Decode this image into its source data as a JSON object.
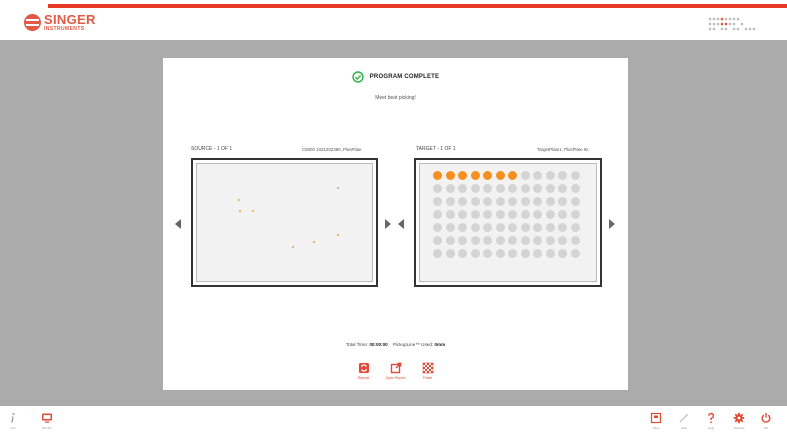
{
  "brand": {
    "name": "SINGER",
    "sub": "INSTRUMENTS",
    "color": "#e05a45"
  },
  "status": {
    "title": "PROGRAM COMPLETE",
    "subtitle": "Meet beat picking!"
  },
  "source": {
    "label": "SOURCE - 1 OF 1",
    "meta": "C9000 1021202390, PlusPlate"
  },
  "target": {
    "label": "TARGET - 1 OF 1",
    "meta": "TargetPlate1, PlusPlate 9x",
    "wells": {
      "rows": 7,
      "cols": 12,
      "filled_in_first_row": 7
    }
  },
  "summary": {
    "total_time_label": "Total Time:",
    "total_time": "00:00:00",
    "pickup_label": "PickupLine™ Used:",
    "pickup_value": "0mm"
  },
  "actions": [
    {
      "label": "Repeat",
      "icon": "repeat-icon"
    },
    {
      "label": "Open Report",
      "icon": "open-report-icon"
    },
    {
      "label": "Finish",
      "icon": "finish-flag-icon"
    }
  ],
  "footer": {
    "left": [
      {
        "label": "Info",
        "icon": "info-icon"
      },
      {
        "label": "Monitor",
        "icon": "monitor-icon"
      }
    ],
    "right": [
      {
        "label": "Save",
        "icon": "save-icon"
      },
      {
        "label": "Edit",
        "icon": "pencil-icon"
      },
      {
        "label": "Help",
        "icon": "help-icon"
      },
      {
        "label": "Settings",
        "icon": "gear-icon"
      },
      {
        "label": "Off",
        "icon": "power-icon"
      }
    ]
  },
  "colors": {
    "accent": "#e63a24",
    "success": "#2db34a",
    "well_filled": "#f5901e",
    "well_empty": "#d4d4d4",
    "background": "#ababab"
  }
}
